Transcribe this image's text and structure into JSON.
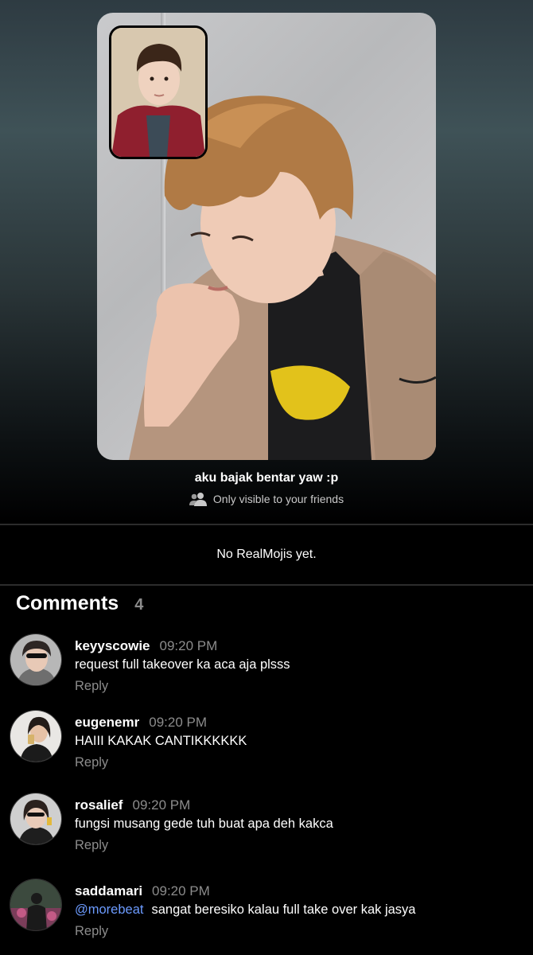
{
  "post": {
    "caption": "aku bajak bentar yaw :p",
    "visibility_icon": "friends-icon",
    "visibility_text": "Only visible to your friends"
  },
  "realmojis": {
    "empty_text": "No RealMojis yet."
  },
  "comments": {
    "title": "Comments",
    "count": "4",
    "reply_label": "Reply",
    "items": [
      {
        "username": "keyyscowie",
        "time": "09:20 PM",
        "text": "request full takeover ka aca aja plsss"
      },
      {
        "username": "eugenemr",
        "time": "09:20 PM",
        "text": "HAIII KAKAK CANTIKKKKKK"
      },
      {
        "username": "rosalief",
        "time": "09:20 PM",
        "text": "fungsi musang gede tuh buat apa deh kakca"
      },
      {
        "username": "saddamari",
        "time": "09:20 PM",
        "mention": "@morebeat",
        "text": "sangat beresiko kalau full take over kak jasya"
      }
    ]
  },
  "colors": {
    "background": "#000000",
    "muted_text": "#8c8c8c",
    "mention": "#6c9bff"
  }
}
